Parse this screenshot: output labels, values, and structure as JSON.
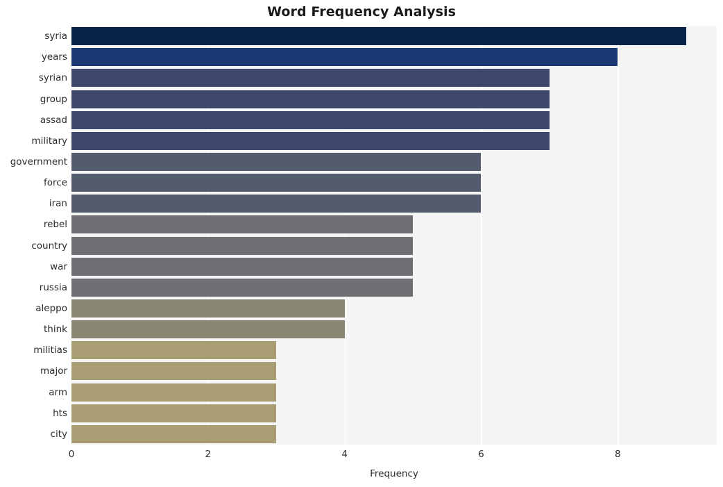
{
  "chart_data": {
    "type": "bar",
    "orientation": "horizontal",
    "title": "Word Frequency Analysis",
    "xlabel": "Frequency",
    "ylabel": "",
    "categories": [
      "syria",
      "years",
      "syrian",
      "group",
      "assad",
      "military",
      "government",
      "force",
      "iran",
      "rebel",
      "country",
      "war",
      "russia",
      "aleppo",
      "think",
      "militias",
      "major",
      "arm",
      "hts",
      "city"
    ],
    "values": [
      9,
      8,
      7,
      7,
      7,
      7,
      6,
      6,
      6,
      5,
      5,
      5,
      5,
      4,
      4,
      3,
      3,
      3,
      3,
      3
    ],
    "bar_colors": [
      "#072348",
      "#193a72",
      "#3e486d",
      "#3e486d",
      "#3e486d",
      "#3e486d",
      "#555b6e",
      "#555b6e",
      "#555b6e",
      "#6e6e73",
      "#6e6e73",
      "#6e6e73",
      "#6e6e73",
      "#888572",
      "#888572",
      "#a99e73",
      "#a99e73",
      "#a99e73",
      "#a99e73",
      "#a99e73"
    ],
    "xlim": [
      0,
      9.45
    ],
    "xticks": [
      0,
      2,
      4,
      6,
      8
    ],
    "xtick_labels": [
      "0",
      "2",
      "4",
      "6",
      "8"
    ],
    "grid": true,
    "grid_axis": "x",
    "grid_color": "#ffffff",
    "legend": "none",
    "plot_background": "#f5f5f6",
    "figure_background": "#ffffff"
  }
}
